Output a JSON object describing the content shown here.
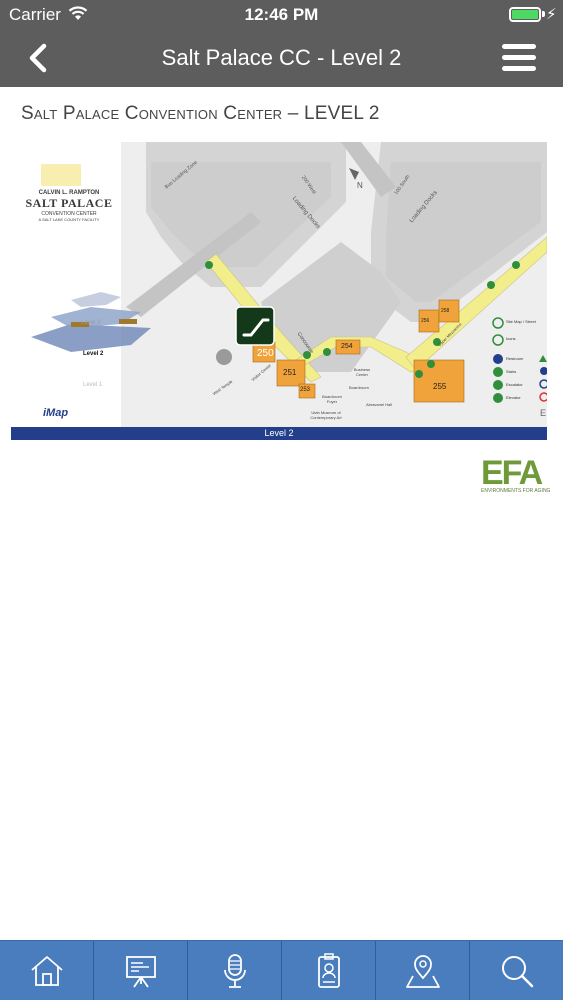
{
  "status_bar": {
    "carrier": "Carrier",
    "time": "12:46 PM",
    "battery_level": 1.0,
    "battery_color": "#4cd964"
  },
  "nav": {
    "title": "Salt Palace CC - Level 2",
    "back_icon": "chevron-left-icon",
    "menu_icon": "hamburger-menu-icon"
  },
  "map": {
    "heading_prefix": "Salt Palace Convention Center – ",
    "heading_level": "LEVEL 2",
    "logo_line1": "CALVIN L. RAMPTON",
    "logo_line2": "SALT PALACE",
    "logo_line3": "CONVENTION CENTER",
    "logo_line4": "A SALT LAKE COUNTY FACILITY",
    "inset_levels": [
      "Level 3",
      "Level 2",
      "Level 1"
    ],
    "imap_logo": "iMap",
    "footer_bar": "Level 2",
    "compass": "N",
    "rooms": [
      "250",
      "251",
      "253",
      "254",
      "255",
      "256",
      "258"
    ],
    "labels": {
      "bus_loading": "Bus Loading Zone",
      "loading_docks_1": "Loading Docks",
      "loading_docks_2": "Loading Docks",
      "west_200": "200 West",
      "south_100": "100 South",
      "concourse": "Concourse",
      "business_center": "Business Center",
      "boardroom": "Boardroom",
      "boardroom_foyer": "Boardroom Foyer",
      "abravanel": "Abravanel Hall",
      "museum": "Utah Museum of Contemporary Art",
      "west_temple": "West Temple",
      "upper_mezzanine": "Upper Mezzanine",
      "visitor_center": "Visitor Center",
      "east_edge": "E"
    },
    "legend": [
      "Site Map / Street",
      "Icons",
      "Restroom",
      "Stairs",
      "Escalator",
      "Elevator"
    ],
    "accent_yellow": "#f2ee8c",
    "room_orange": "#f0a33a",
    "road_gray": "#c9c9c9",
    "building_gray": "#d9d9d9",
    "legend_green": "#2f8f3a",
    "footer_blue": "#233f8c",
    "selected_marker_icon": "escalator-icon"
  },
  "efa_logo": {
    "text": "EFA",
    "sub": "ENVIRONMENTS FOR AGING"
  },
  "tabs": [
    {
      "name": "home",
      "icon": "home-icon"
    },
    {
      "name": "presentations",
      "icon": "presentation-board-icon"
    },
    {
      "name": "speakers",
      "icon": "microphone-icon"
    },
    {
      "name": "badge",
      "icon": "id-badge-icon"
    },
    {
      "name": "map",
      "icon": "map-pin-icon"
    },
    {
      "name": "search",
      "icon": "search-icon"
    }
  ],
  "tab_bar_color": "#4a7dbd"
}
